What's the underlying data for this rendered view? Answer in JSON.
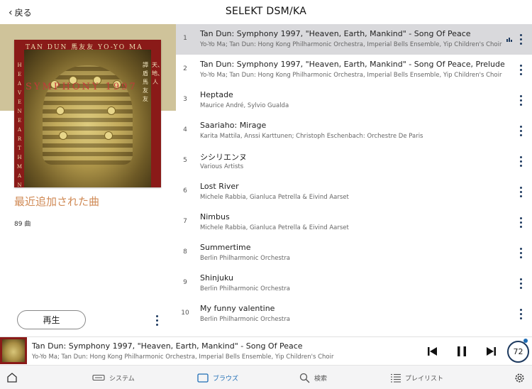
{
  "header": {
    "back_label": "戻る",
    "title": "SELEKT DSM/KA"
  },
  "album_art": {
    "top_line": "TAN DUN  馬友友  YO-YO MA",
    "center_line": "SYMPHONY 1997",
    "left_vertical": "HEAVEN EARTH MANKIND",
    "right_vertical_a": "譚盾馬友友",
    "right_vertical_b": "天、地、人"
  },
  "playlist": {
    "name": "最近追加された曲",
    "track_count": "89 曲",
    "play_label": "再生"
  },
  "tracks": [
    {
      "num": "1",
      "title": "Tan Dun: Symphony 1997, \"Heaven, Earth, Mankind\" - Song Of Peace",
      "artist": "Yo-Yo Ma; Tan Dun: Hong Kong Philharmonic Orchestra, Imperial Bells Ensemble, Yip Children's Choir"
    },
    {
      "num": "2",
      "title": "Tan Dun: Symphony 1997, \"Heaven, Earth, Mankind\" - Song Of Peace, Prelude",
      "artist": "Yo-Yo Ma; Tan Dun: Hong Kong Philharmonic Orchestra, Imperial Bells Ensemble, Yip Children's Choir"
    },
    {
      "num": "3",
      "title": "Heptade",
      "artist": "Maurice André, Sylvio Gualda"
    },
    {
      "num": "4",
      "title": "Saariaho: Mirage",
      "artist": "Karita Mattila, Anssi Karttunen; Christoph Eschenbach: Orchestre De Paris"
    },
    {
      "num": "5",
      "title": "シシリエンヌ",
      "artist": "Various Artists"
    },
    {
      "num": "6",
      "title": "Lost River",
      "artist": "Michele Rabbia, Gianluca Petrella & Eivind Aarset"
    },
    {
      "num": "7",
      "title": "Nimbus",
      "artist": "Michele Rabbia, Gianluca Petrella & Eivind Aarset"
    },
    {
      "num": "8",
      "title": "Summertime",
      "artist": "Berlin Philharmonic Orchestra"
    },
    {
      "num": "9",
      "title": "Shinjuku",
      "artist": "Berlin Philharmonic Orchestra"
    },
    {
      "num": "10",
      "title": "My funny valentine",
      "artist": "Berlin Philharmonic Orchestra"
    }
  ],
  "now_playing": {
    "title": "Tan Dun: Symphony 1997, \"Heaven, Earth, Mankind\" - Song Of Peace",
    "artist": "Yo-Yo Ma; Tan Dun: Hong Kong Philharmonic Orchestra, Imperial Bells Ensemble, Yip Children's Choir",
    "volume": "72"
  },
  "tabs": {
    "home_icon": "home-icon",
    "system": "システム",
    "browse": "ブラウズ",
    "search": "検索",
    "playlist": "プレイリスト",
    "settings_icon": "gear-icon"
  },
  "colors": {
    "accent": "#1e6db5",
    "playlist_name": "#d08a55",
    "active_row": "#d9d9dc",
    "art_red": "#8a1a18"
  }
}
